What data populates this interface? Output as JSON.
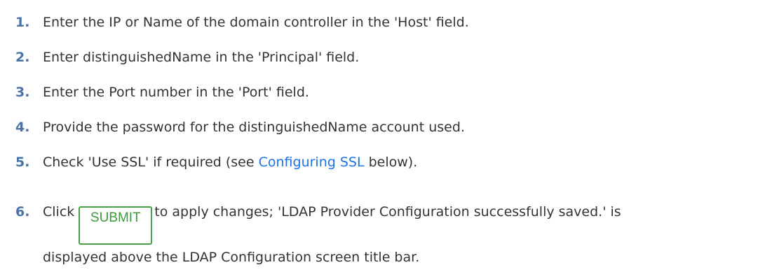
{
  "steps": [
    {
      "number": "1.",
      "text": "Enter the IP or Name of the domain controller in the 'Host' field."
    },
    {
      "number": "2.",
      "text": "Enter distinguishedName in the 'Principal' field."
    },
    {
      "number": "3.",
      "text": "Enter the Port number in the 'Port' field."
    },
    {
      "number": "4.",
      "text": "Provide the password for the distinguishedName account used."
    },
    {
      "number": "5.",
      "text_before": "Check 'Use SSL' if required (see ",
      "link": "Configuring SSL",
      "text_after": " below)."
    },
    {
      "number": "6.",
      "text_before": "Click",
      "button": "SUBMIT",
      "text_after": "to apply changes; 'LDAP Provider Configuration successfully saved.' is",
      "text_line2": "displayed above the LDAP Configuration screen title bar."
    }
  ],
  "colors": {
    "step_number": "#4a73a8",
    "link": "#1a73e8",
    "button_border": "#43a047",
    "button_text": "#3c9b3f",
    "body_text": "#333333"
  }
}
